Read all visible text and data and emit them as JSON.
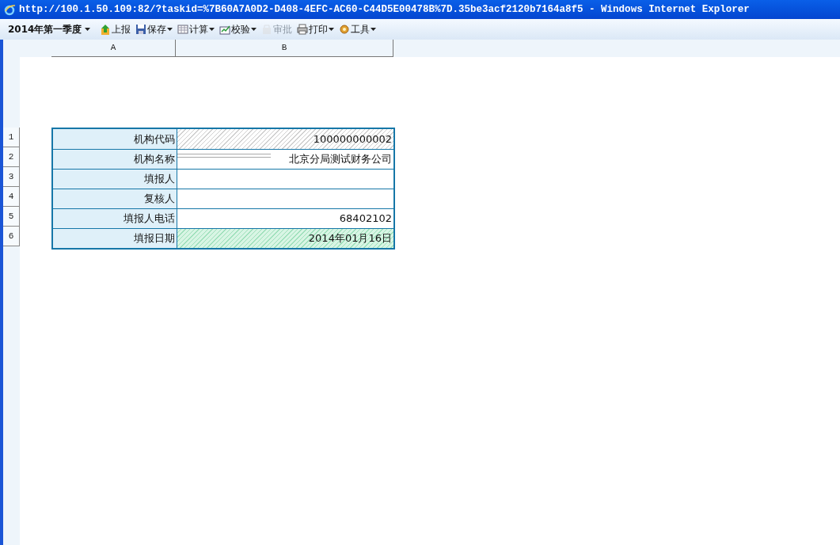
{
  "window": {
    "title": "http://100.1.50.109:82/?taskid=%7B60A7A0D2-D408-4EFC-AC60-C44D5E00478B%7D.35be3acf2120b7164a8f5 - Windows Internet Explorer"
  },
  "toolbar": {
    "period": {
      "label": "2014年第一季度",
      "dropdown": true
    },
    "buttons": [
      {
        "label": "上报",
        "dropdown": false,
        "disabled": false
      },
      {
        "label": "保存",
        "dropdown": true,
        "disabled": false
      },
      {
        "label": "计算",
        "dropdown": true,
        "disabled": false
      },
      {
        "label": "校验",
        "dropdown": true,
        "disabled": false
      },
      {
        "label": "审批",
        "dropdown": false,
        "disabled": true
      },
      {
        "label": "打印",
        "dropdown": true,
        "disabled": false
      },
      {
        "label": "工具",
        "dropdown": true,
        "disabled": false
      }
    ]
  },
  "sheet": {
    "columns": [
      "A",
      "B"
    ],
    "rows": [
      {
        "number": "1",
        "label": "机构代码",
        "value": "100000000002",
        "kind": "locked"
      },
      {
        "number": "2",
        "label": "机构名称",
        "value": "北京分局测试财务公司",
        "kind": "prefilled"
      },
      {
        "number": "3",
        "label": "填报人",
        "kind": "input"
      },
      {
        "number": "4",
        "label": "复核人",
        "kind": "input"
      },
      {
        "number": "5",
        "label": "填报人电话",
        "value": "68402102",
        "kind": "input"
      },
      {
        "number": "6",
        "label": "填报日期",
        "value": "2014年01月16日",
        "kind": "date"
      }
    ]
  }
}
